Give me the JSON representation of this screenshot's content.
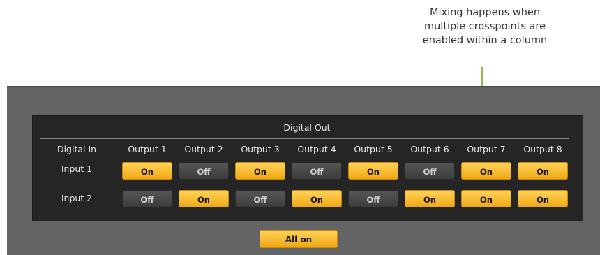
{
  "annotation": {
    "lines": [
      "Mixing happens when",
      "multiple crosspoints are",
      "enabled within a column"
    ]
  },
  "matrix": {
    "header": "Digital Out",
    "row_header": "Digital In",
    "outputs": [
      "Output 1",
      "Output 2",
      "Output 3",
      "Output 4",
      "Output 5",
      "Output 6",
      "Output 7",
      "Output 8"
    ],
    "inputs": [
      {
        "label": "Input 1",
        "states": [
          "On",
          "Off",
          "On",
          "Off",
          "On",
          "Off",
          "On",
          "On"
        ]
      },
      {
        "label": "Input 2",
        "states": [
          "Off",
          "On",
          "Off",
          "On",
          "Off",
          "On",
          "On",
          "On"
        ]
      }
    ]
  },
  "all_on_label": "All on",
  "colors": {
    "on": "#f5b820",
    "off": "#4a4a4a",
    "arrow": "#8bc34a"
  }
}
